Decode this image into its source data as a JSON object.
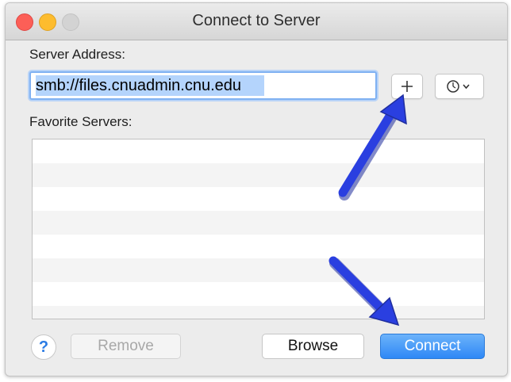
{
  "window": {
    "title": "Connect to Server"
  },
  "server_address": {
    "label": "Server Address:",
    "value": "smb://files.cnuadmin.cnu.edu"
  },
  "favorites": {
    "label": "Favorite Servers:",
    "rows": [
      "",
      "",
      "",
      "",
      "",
      "",
      "",
      ""
    ]
  },
  "buttons": {
    "help": "?",
    "remove": "Remove",
    "browse": "Browse",
    "connect": "Connect",
    "add_favorite_icon": "plus-icon",
    "recent_servers_icon": "clock-icon"
  },
  "colors": {
    "accent": "#2e88f6",
    "annotation_arrow": "#2a3fe0"
  }
}
